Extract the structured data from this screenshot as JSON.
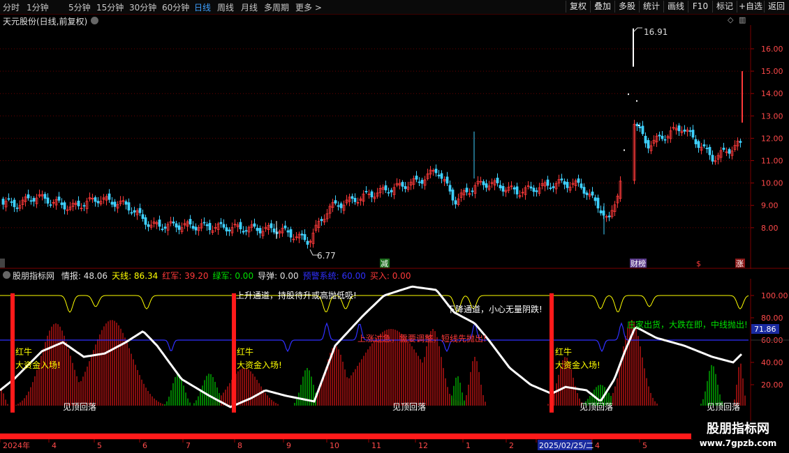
{
  "toolbar": {
    "periods": [
      "分时",
      "1分钟",
      "5分钟",
      "15分钟",
      "30分钟",
      "60分钟",
      "日线",
      "周线",
      "月线",
      "多周期",
      "更多 >"
    ],
    "active_period": "日线",
    "buttons": [
      "复权",
      "叠加",
      "多股",
      "统计",
      "画线",
      "F10",
      "标记",
      "+自选",
      "返回"
    ]
  },
  "main_chart": {
    "title": "天元股份(日线,前复权)",
    "price_axis": [
      "16.00",
      "15.00",
      "14.00",
      "13.00",
      "12.00",
      "11.00",
      "10.00",
      "9.00",
      "8.00"
    ],
    "high_label": "16.91",
    "low_label": "6.77",
    "markers": [
      "减",
      "财榜",
      "$",
      "涨"
    ],
    "colors": {
      "up": "#ff3a3a",
      "down": "#3fd0ff"
    }
  },
  "indicator": {
    "name": "股朋指标网",
    "readouts": [
      {
        "label": "情报:",
        "value": "48.06",
        "color": "#e0e0e0"
      },
      {
        "label": "天线:",
        "value": "86.34",
        "color": "#ffff00"
      },
      {
        "label": "红军:",
        "value": "39.20",
        "color": "#ff3a3a"
      },
      {
        "label": "绿军:",
        "value": "0.00",
        "color": "#00e000"
      },
      {
        "label": "导弹:",
        "value": "0.00",
        "color": "#e0e0e0"
      },
      {
        "label": "预警系统:",
        "value": "60.00",
        "color": "#3030ff"
      },
      {
        "label": "买入:",
        "value": "0.00",
        "color": "#ff3a3a"
      }
    ],
    "axis": [
      "100.00",
      "80.00",
      "60.00",
      "40.00",
      "20.00"
    ],
    "current_value": "71.86",
    "annotations": {
      "red_bull": "红牛",
      "big_money": "大资金入场!",
      "see_top": "见顶回落",
      "uptrend": "上升通道，持股待升或高抛低吸!",
      "downtrend": "下降通道，小心无量阴跌!",
      "rising_fast": "上涨过急，需要调整，短线先抛出!",
      "dealer_selling": "庄家出货，大跌在即，中线抛出!"
    }
  },
  "date_axis": {
    "labels": [
      "2024年",
      "4",
      "5",
      "6",
      "7",
      "8",
      "9",
      "10",
      "11",
      "12",
      "1",
      "2",
      "2025/02/25/二",
      "4",
      "5"
    ],
    "highlighted": "2025/02/25/二"
  },
  "watermark": {
    "title": "股朋指标网",
    "url": "www.7gpzb.com"
  }
}
